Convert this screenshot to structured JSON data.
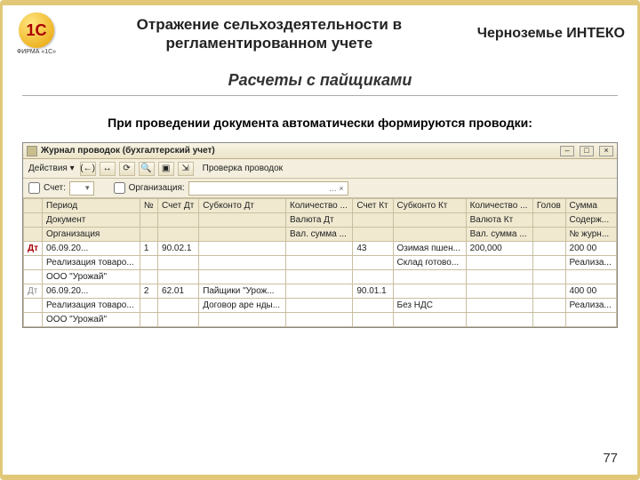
{
  "logo": {
    "text": "1С",
    "sub": "ФИРМА «1С»"
  },
  "header": {
    "title_line1": "Отражение сельхоздеятельности в",
    "title_line2": "регламентированном учете",
    "brand": "Черноземье ИНТЕКО"
  },
  "subtitle": "Расчеты с пайщиками",
  "caption": "При проведении документа автоматически формируются проводки:",
  "app": {
    "title": "Журнал проводок (бухгалтерский учет)",
    "toolbar": {
      "actions": "Действия ▾",
      "check": "Проверка проводок"
    },
    "filter": {
      "acct_label": "Счет:",
      "org_label": "Организация:"
    },
    "headers": {
      "r1": [
        "",
        "Период",
        "№",
        "Счет Дт",
        "Субконто Дт",
        "Количество ...",
        "Счет Кт",
        "Субконто Кт",
        "Количество ...",
        "Голов",
        "Сумма"
      ],
      "r2": [
        "",
        "Документ",
        "",
        "",
        "",
        "Валюта Дт",
        "",
        "",
        "Валюта Кт",
        "",
        "Содерж..."
      ],
      "r3": [
        "",
        "Организация",
        "",
        "",
        "",
        "Вал. сумма ...",
        "",
        "",
        "Вал. сумма ...",
        "",
        "№ журн..."
      ]
    },
    "rows": [
      {
        "mark": "Дт",
        "c": [
          "06.09.20...",
          "1",
          "90.02.1",
          "",
          "",
          "43",
          "Озимая пшен...",
          "200,000",
          "",
          "200 00"
        ]
      },
      {
        "mark": "",
        "c": [
          "Реализация товаро...",
          "",
          "",
          "",
          "",
          "",
          "Склад готово...",
          "",
          "",
          "Реализа..."
        ]
      },
      {
        "mark": "",
        "c": [
          "ООО \"Урожай\"",
          "",
          "",
          "",
          "",
          "",
          "",
          "",
          "",
          ""
        ]
      },
      {
        "mark": "Дт",
        "c": [
          "06.09.20...",
          "2",
          "62.01",
          "Пайщики \"Урож...",
          "",
          "90.01.1",
          "",
          "",
          "",
          "400 00"
        ]
      },
      {
        "mark": "",
        "c": [
          "Реализация товаро...",
          "",
          "",
          "Договор аре нды...",
          "",
          "",
          "Без НДС",
          "",
          "",
          "Реализа..."
        ]
      },
      {
        "mark": "",
        "c": [
          "ООО \"Урожай\"",
          "",
          "",
          "",
          "",
          "",
          "",
          "",
          "",
          ""
        ]
      }
    ]
  },
  "page_no": "77"
}
